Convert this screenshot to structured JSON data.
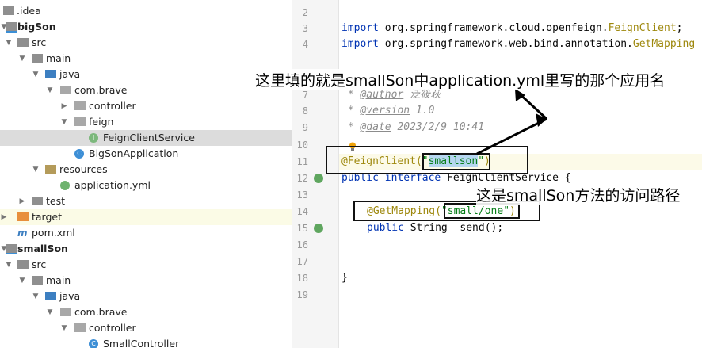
{
  "tree": {
    "items": [
      {
        "label": ".idea"
      },
      {
        "label": "bigSon"
      },
      {
        "label": "src"
      },
      {
        "label": "main"
      },
      {
        "label": "java"
      },
      {
        "label": "com.brave"
      },
      {
        "label": "controller"
      },
      {
        "label": "feign"
      },
      {
        "label": "FeignClientService"
      },
      {
        "label": "BigSonApplication"
      },
      {
        "label": "resources"
      },
      {
        "label": "application.yml"
      },
      {
        "label": "test"
      },
      {
        "label": "target"
      },
      {
        "label": "pom.xml"
      },
      {
        "label": "smallSon"
      },
      {
        "label": "src"
      },
      {
        "label": "main"
      },
      {
        "label": "java"
      },
      {
        "label": "com.brave"
      },
      {
        "label": "controller"
      },
      {
        "label": "SmallController"
      }
    ]
  },
  "editor": {
    "line_numbers": [
      "2",
      "3",
      "4",
      "7",
      "8",
      "9",
      "10",
      "11",
      "12",
      "13",
      "14",
      "15",
      "16",
      "17",
      "18",
      "19"
    ],
    "import1_kw": "import",
    "import1_pkg": " org.springframework.cloud.openfeign.",
    "import1_cls": "FeignClient",
    "import1_end": ";",
    "import2_kw": "import",
    "import2_pkg": " org.springframework.web.bind.annotation.",
    "import2_cls": "GetMapping",
    "doc_author_tag": "@author",
    "doc_author_val": " 泛筱荻",
    "doc_version_tag": "@version",
    "doc_version_val": " 1.0",
    "doc_date_tag": "@date",
    "doc_date_val": " 2023/2/9 10:41",
    "doc_star": " * ",
    "feign_ann": "@FeignClient(",
    "feign_str_q1": "\"",
    "feign_str": "smallson",
    "feign_str_q2": "\"",
    "feign_close": ")",
    "iface_kw1": "public",
    "iface_kw2": "interface",
    "iface_name": " FeignClientService {",
    "getmapping_ann": "@GetMapping(",
    "getmapping_str": "\"small/one\"",
    "getmapping_close": ")",
    "method_kw": "public",
    "method_rest": " String  send();",
    "close_brace": "}"
  },
  "callouts": {
    "top": "这里填的就是smallSon中application.yml里写的那个应用名",
    "bottom": "这是smallSon方法的访问路径"
  },
  "colors": {
    "keyword": "#0033b3",
    "annotation": "#9e880d",
    "string": "#067d17",
    "comment": "#8c8c8c",
    "selection": "#dcdcdc"
  }
}
